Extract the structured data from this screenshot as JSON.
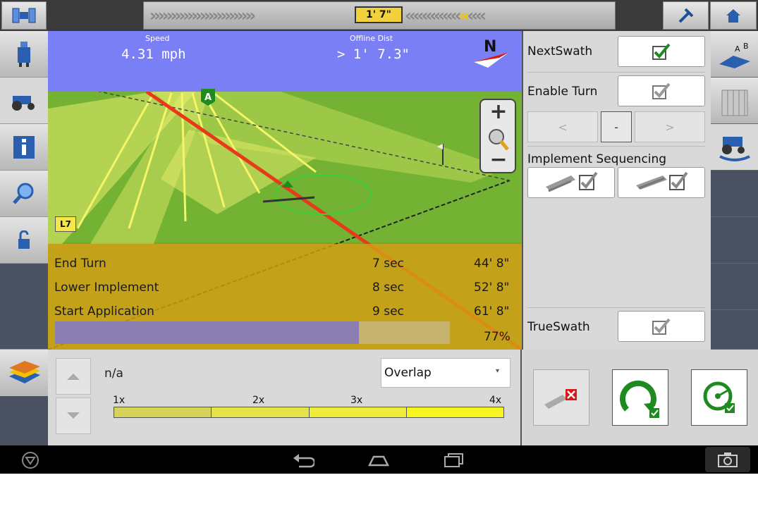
{
  "topbar": {
    "offline_indicator": "1' 7\"",
    "left_icon": "satellite-icon",
    "tool_icon": "wrench-icon",
    "home_icon": "home-icon"
  },
  "sidebar_left": {
    "items": [
      {
        "name": "gps-receiver",
        "icon": "receiver-icon"
      },
      {
        "name": "vehicle",
        "icon": "tractor-icon"
      },
      {
        "name": "info",
        "icon": "info-icon"
      },
      {
        "name": "zoom",
        "icon": "magnifier-icon"
      },
      {
        "name": "lock",
        "icon": "lock-icon"
      }
    ]
  },
  "map": {
    "speed_label": "Speed",
    "speed_value": "4.31 mph",
    "offline_label": "Offline Dist",
    "offline_value": "> 1' 7.3\"",
    "compass": "N",
    "marker_a": "A",
    "marker_l": "L7",
    "events": [
      {
        "name": "End Turn",
        "time": "7 sec",
        "dist": "44' 8\""
      },
      {
        "name": "Lower Implement",
        "time": "8 sec",
        "dist": "52' 8\""
      },
      {
        "name": "Start Application",
        "time": "9 sec",
        "dist": "61' 8\""
      }
    ],
    "progress_percent": 77,
    "progress_label": "77%"
  },
  "right_panel": {
    "nextswath_label": "NextSwath",
    "nextswath_checked": true,
    "enable_turn_label": "Enable Turn",
    "enable_turn_checked": false,
    "nav_prev": "<",
    "nav_mid": "-",
    "nav_next": ">",
    "implement_sequencing_label": "Implement Sequencing",
    "trueswath_label": "TrueSwath",
    "trueswath_checked": false
  },
  "bottom": {
    "value": "n/a",
    "dropdown_value": "Overlap",
    "scale_labels": [
      "1x",
      "2x",
      "3x",
      "4x"
    ]
  },
  "colors": {
    "sky": "#7b7ff5",
    "field": "#6ea82e",
    "event_panel": "#d6a014",
    "guidance_line": "#e83a1a",
    "check_green": "#1f8a1f"
  }
}
